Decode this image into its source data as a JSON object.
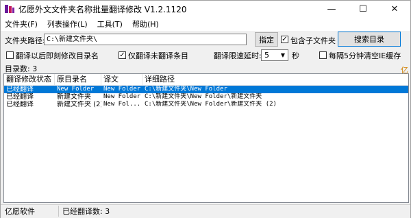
{
  "window": {
    "title": "亿愿外文文件夹名称批量翻译修改 V1.2.1120",
    "minimize": "—",
    "maximize": "☐",
    "close": "✕"
  },
  "menu": {
    "items": [
      "文件夹(F)",
      "列表操作(L)",
      "工具(T)",
      "帮助(H)"
    ]
  },
  "toolbar": {
    "path_label": "文件夹路径:",
    "path_value": "C:\\新建文件夹\\",
    "specify_button": "指定",
    "include_subfolders_label": "包含子文件夹",
    "include_subfolders_checked": true,
    "search_button": "搜索目录",
    "rename_after_translate_label": "翻译以后即刻修改目录名",
    "rename_after_translate_checked": false,
    "only_untranslated_label": "仅翻译未翻译条目",
    "only_untranslated_checked": true,
    "delay_label": "翻译限速延时:",
    "delay_value": "5",
    "delay_unit": "秒",
    "clear_cache_label": "每隔5分钟清空IE缓存",
    "clear_cache_checked": false
  },
  "dir_count_label": "目录数: 3",
  "corner_link": "亿",
  "table": {
    "columns": [
      "翻译修改状态",
      "原目录名",
      "译文",
      "详细路径"
    ],
    "rows": [
      {
        "status": "已经翻译",
        "original": "New Folder",
        "translation": "New Folder",
        "path": "C:\\新建文件夹\\New Folder",
        "selected": true
      },
      {
        "status": "已经翻译",
        "original": "新建文件夹",
        "translation": "New Folder",
        "path": "C:\\新建文件夹\\New Folder\\新建文件夹",
        "selected": false
      },
      {
        "status": "已经翻译",
        "original": "新建文件夹 (2)",
        "translation": "New Fol...",
        "path": "C:\\新建文件夹\\New Folder\\新建文件夹 (2)",
        "selected": false
      }
    ]
  },
  "status": {
    "brand": "亿愿软件",
    "translated_count": "已经翻译数: 3"
  }
}
